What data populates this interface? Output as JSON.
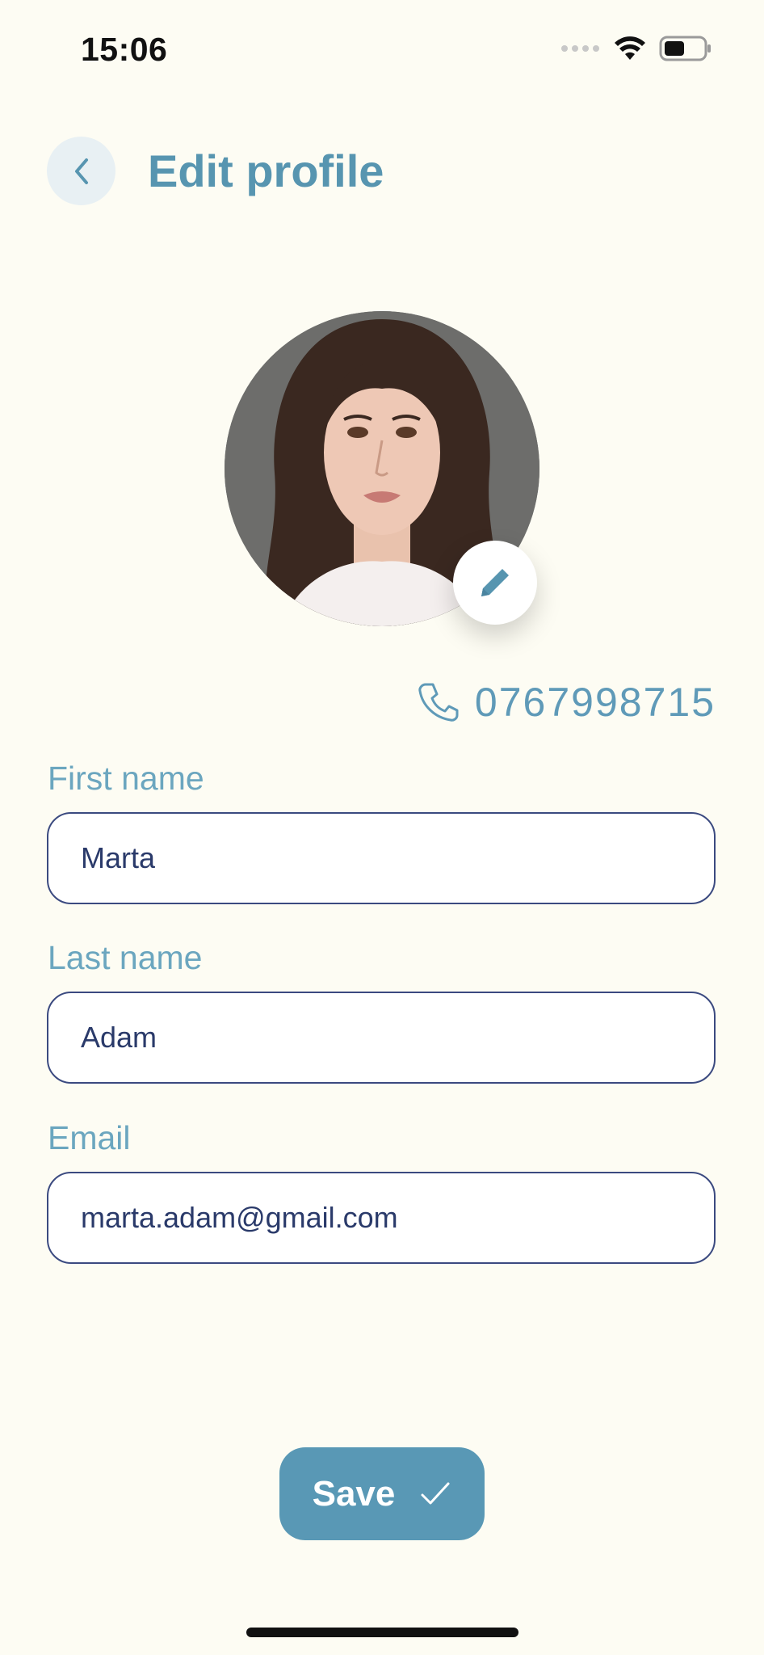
{
  "status_bar": {
    "time": "15:06"
  },
  "header": {
    "title": "Edit profile"
  },
  "profile": {
    "phone": "0767998715"
  },
  "form": {
    "first_name": {
      "label": "First name",
      "value": "Marta"
    },
    "last_name": {
      "label": "Last name",
      "value": "Adam"
    },
    "email": {
      "label": "Email",
      "value": "marta.adam@gmail.com"
    }
  },
  "actions": {
    "save_label": "Save"
  },
  "colors": {
    "background": "#fdfcf3",
    "accent": "#5998b5",
    "field_border": "#3b4a80"
  },
  "icons": {
    "back": "chevron-left-icon",
    "edit": "pencil-icon",
    "phone": "phone-icon",
    "save": "checkmark-icon"
  }
}
